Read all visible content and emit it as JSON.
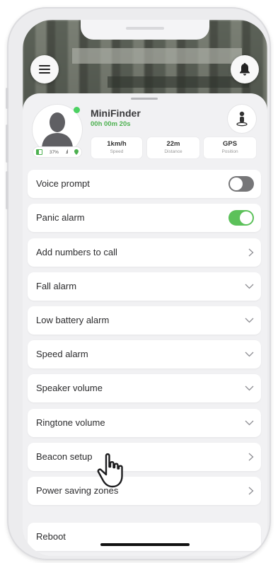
{
  "device": {
    "name": "MiniFinder",
    "timer": "00h 00m 20s",
    "battery": "37%"
  },
  "stats": [
    {
      "value": "1km/h",
      "label": "Speed"
    },
    {
      "value": "22m",
      "label": "Distance"
    },
    {
      "value": "GPS",
      "label": "Position"
    }
  ],
  "settings": [
    {
      "label": "Voice prompt",
      "control": "toggle",
      "state": "off"
    },
    {
      "label": "Panic alarm",
      "control": "toggle",
      "state": "on"
    },
    {
      "label": "Add numbers to call",
      "control": "chevron-right"
    },
    {
      "label": "Fall alarm",
      "control": "chevron-down"
    },
    {
      "label": "Low battery alarm",
      "control": "chevron-down"
    },
    {
      "label": "Speed alarm",
      "control": "chevron-down"
    },
    {
      "label": "Speaker volume",
      "control": "chevron-down"
    },
    {
      "label": "Ringtone volume",
      "control": "chevron-down"
    },
    {
      "label": "Beacon setup",
      "control": "chevron-right"
    },
    {
      "label": "Power saving zones",
      "control": "chevron-right"
    },
    {
      "label": "Reboot",
      "control": "none"
    }
  ],
  "icons": {
    "menu": "hamburger-menu-icon",
    "bell": "bell-icon",
    "pin": "person-pin-icon",
    "pointer": "hand-pointer-icon"
  },
  "colors": {
    "accent": "#5cc15a",
    "online": "#4cd162",
    "timer": "#4cb04f"
  }
}
